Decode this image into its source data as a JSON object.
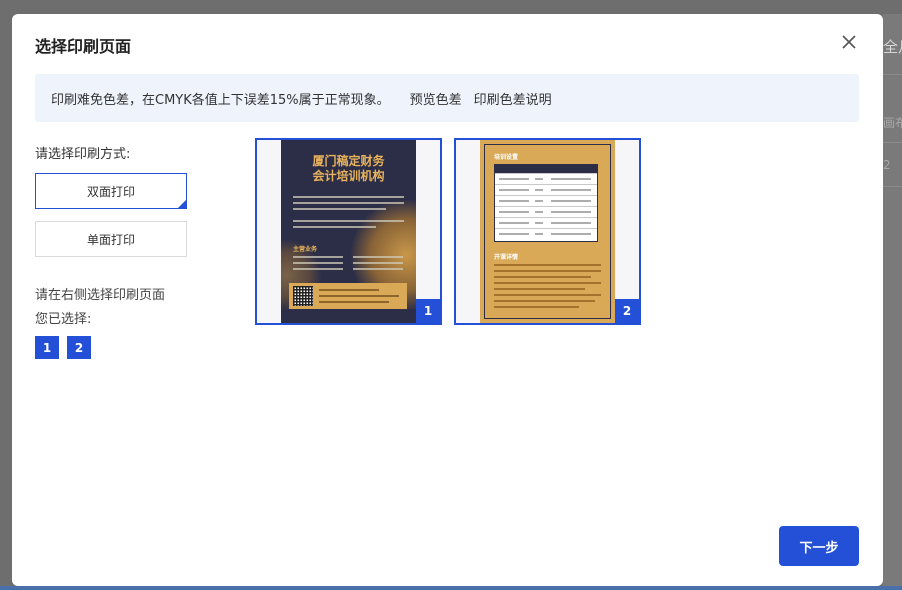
{
  "background": {
    "peek_1": "全月",
    "peek_2": "画布",
    "peek_3": "2"
  },
  "dialog": {
    "title": "选择印刷页面",
    "close_icon": "close-icon"
  },
  "notice": {
    "text": "印刷难免色差，在CMYK各值上下误差15%属于正常现象。",
    "preview_link": "预览色差",
    "explain_link": "印刷色差说明"
  },
  "print_mode": {
    "label": "请选择印刷方式:",
    "options": [
      "双面打印",
      "单面打印"
    ],
    "selected": "双面打印"
  },
  "selection": {
    "hint": "请在右侧选择印刷页面",
    "selected_label": "您已选择:",
    "selected_pages": [
      "1",
      "2"
    ]
  },
  "pages": [
    {
      "number": "1",
      "selected": true,
      "title_line1": "厦门稿定财务",
      "title_line2": "会计培训机构",
      "section": "主营业务"
    },
    {
      "number": "2",
      "selected": true,
      "heading1": "培训设置",
      "heading2": "开课详情"
    }
  ],
  "actions": {
    "next": "下一步"
  },
  "colors": {
    "accent": "#2450d8",
    "notice_bg": "#eef3fc",
    "poster_dark": "#2c2e48",
    "poster_gold": "#d9a958"
  }
}
